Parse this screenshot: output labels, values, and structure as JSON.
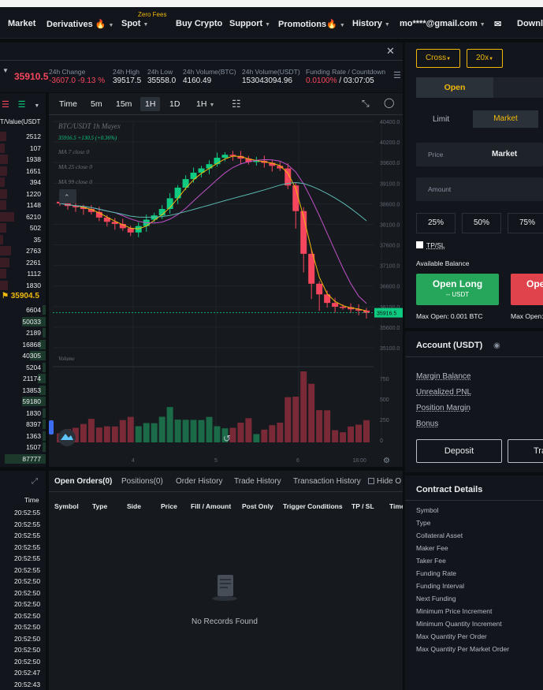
{
  "nav": {
    "items": [
      "Market",
      "Derivatives",
      "Spot",
      "Buy Crypto",
      "Support",
      "Promotions",
      "History",
      "mo****@gmail.com"
    ],
    "spot_badge": "Zero Fees",
    "download": "Downlo"
  },
  "ticker": {
    "price": "35910.5",
    "change_label": "24h Change",
    "change_value": "-3607.0 -9.13 %",
    "high_label": "24h High",
    "high_value": "39517.5",
    "low_label": "24h Low",
    "low_value": "35558.0",
    "vol_btc_label": "24h Volume(BTC)",
    "vol_btc_value": "4160.49",
    "vol_usdt_label": "24h Volume(USDT)",
    "vol_usdt_value": "153043094.96",
    "funding_label": "Funding Rate / Countdown",
    "funding_rate": "0.0100%",
    "countdown": "/ 03:07:05"
  },
  "book": {
    "header": "T/Value(USDT",
    "asks": [
      "2512",
      "107",
      "1938",
      "1651",
      "394",
      "1220",
      "1148",
      "6210",
      "502",
      "35",
      "2763",
      "2261",
      "1112",
      "1830"
    ],
    "mid_price": "35904.5",
    "bids": [
      "6604",
      "50033",
      "2189",
      "16868",
      "40305",
      "5204",
      "21174",
      "13853",
      "59180",
      "1830",
      "8397",
      "1363",
      "1507",
      "87777"
    ]
  },
  "chart_toolbar": {
    "timeframes": [
      "Time",
      "5m",
      "15m",
      "1H",
      "1D",
      "1H"
    ],
    "active": "1H"
  },
  "chart_data": {
    "type": "line",
    "title": "BTC/USDT 1h Mayex",
    "ohlc_line": "35916.5 +130.5 (+0.36%)",
    "indicators": [
      "MA 7 close 0",
      "MA 25 close 0",
      "MA 99 close 0"
    ],
    "volume_label": "Volume",
    "y_ticks": [
      "40400.0",
      "40200.0",
      "39600.0",
      "39100.0",
      "38600.0",
      "38100.0",
      "37600.0",
      "37100.0",
      "36600.0",
      "36100.0",
      "35600.0",
      "35100.0"
    ],
    "current_price_tag": "35916.5",
    "volume_ticks": [
      "750",
      "500",
      "250",
      "0"
    ],
    "x_ticks": [
      "4",
      "5",
      "6",
      "18:00"
    ],
    "close_series": [
      38480,
      38420,
      38390,
      38350,
      38280,
      38150,
      38050,
      38000,
      37900,
      37800,
      37950,
      38100,
      38200,
      38350,
      38600,
      38850,
      39050,
      39200,
      39300,
      39400,
      39550,
      39620,
      39590,
      39530,
      39450,
      39480,
      39430,
      39360,
      39300,
      38900,
      38300,
      37300,
      36600,
      36350,
      36150,
      36060,
      36050,
      36000,
      35970,
      35920
    ],
    "ylim": [
      35100,
      40400
    ]
  },
  "orders": {
    "tabs": [
      "Open Orders(0)",
      "Positions(0)",
      "Order History",
      "Trade History",
      "Transaction History"
    ],
    "hide_label": "Hide O",
    "columns": [
      "Symbol",
      "Type",
      "Side",
      "Price",
      "Fill / Amount",
      "Post Only",
      "Trigger Conditions",
      "TP / SL",
      "Time"
    ],
    "empty": "No Records Found"
  },
  "trades": {
    "header_time": "Time",
    "times": [
      "20:52:55",
      "20:52:55",
      "20:52:55",
      "20:52:55",
      "20:52:55",
      "20:52:55",
      "20:52:50",
      "20:52:50",
      "20:52:50",
      "20:52:50",
      "20:52:50",
      "20:52:50",
      "20:52:50",
      "20:52:50",
      "20:52:47",
      "20:52:43"
    ]
  },
  "right_panel": {
    "margin_mode": "Cross",
    "leverage": "20x",
    "open_tab": "Open",
    "order_types": [
      "Limit",
      "Market"
    ],
    "price_label": "Price",
    "price_value": "Market",
    "amount_label": "Amount",
    "percents": [
      "25%",
      "50%",
      "75%"
    ],
    "tpsl": "TP/SL",
    "available_balance": "Available Balance",
    "open_long": "Open Long",
    "open_long_sub": "-- USDT",
    "open_short": "Ope",
    "max_open_long": "Max Open: 0.001 BTC",
    "max_open_short": "Max Open:",
    "account_title": "Account (USDT)",
    "account_rows": [
      "Margin Balance",
      "Unrealized PNL",
      "Position Margin",
      "Bonus"
    ],
    "deposit": "Deposit",
    "transfer": "Tra",
    "contract_title": "Contract Details",
    "contract_rows": [
      "Symbol",
      "Type",
      "Collateral Asset",
      "Maker Fee",
      "Taker Fee",
      "Funding Rate",
      "Funding Interval",
      "Next Funding",
      "Minimum Price Increment",
      "Minimum Quantity Increment",
      "Max Quantity Per Order",
      "Max Quantity Per Market Order"
    ]
  },
  "colors": {
    "up": "#0ecb81",
    "down": "#f6465d",
    "accent": "#f0b90b"
  }
}
